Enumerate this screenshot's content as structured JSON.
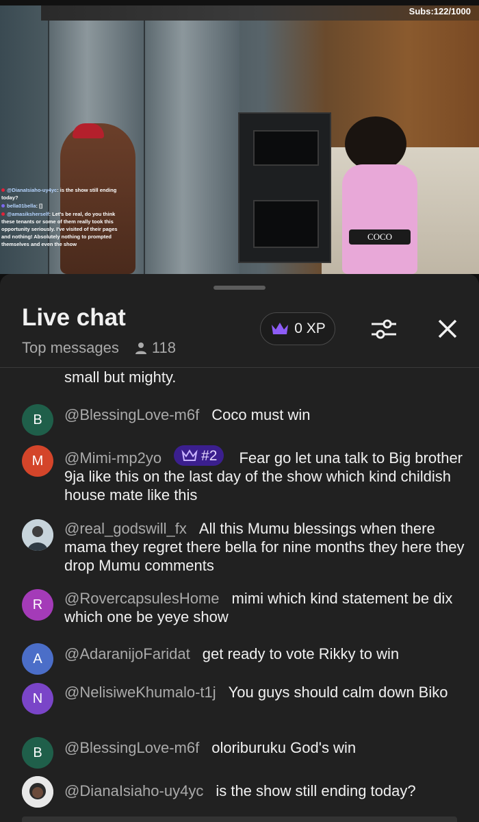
{
  "video": {
    "subs_counter": "Subs:122/1000",
    "belt_text": "COCO",
    "overlay_chat": [
      {
        "user": "@DianaIsiaho-uy4yc",
        "text": ": is the show still ending today?"
      },
      {
        "user": "bella01bella",
        "text": ": []"
      },
      {
        "user": "@amasiksherself",
        "text": ": Let's be real, do you think these tenants or some of them really took this opportunity seriously. I've visited of their pages and nothing! Absolutely nothing to prompted themselves and even the show"
      }
    ]
  },
  "panel": {
    "title": "Live chat",
    "subtitle": "Top messages",
    "viewer_count": "118",
    "xp_label": "0 XP",
    "icons": {
      "xp": "crown-icon",
      "filter": "sliders-icon",
      "close": "close-icon",
      "viewers": "person-icon"
    }
  },
  "messages": [
    {
      "avatar_letter": "",
      "avatar_color": "",
      "author": "",
      "badge": "",
      "text": "small but mighty."
    },
    {
      "avatar_letter": "B",
      "avatar_color": "#1f5f4a",
      "author": "@BlessingLove-m6f",
      "badge": "",
      "text": "Coco must win"
    },
    {
      "avatar_letter": "M",
      "avatar_color": "#d4452a",
      "author": "@Mimi-mp2yo",
      "badge": "#2",
      "text": "Fear go let una talk to Big brother 9ja like this on the last day of the show which kind childish house mate like this"
    },
    {
      "avatar_letter": "",
      "avatar_color": "#8fa6b3",
      "author": "@real_godswill_fx",
      "badge": "",
      "text": "All this Mumu blessings when there mama they regret there bella for nine months they here they drop Mumu comments"
    },
    {
      "avatar_letter": "R",
      "avatar_color": "#a43bb8",
      "author": "@RovercapsulesHome",
      "badge": "",
      "text": "mimi which kind statement be dix which one be yeye show"
    },
    {
      "avatar_letter": "A",
      "avatar_color": "#4b6ec8",
      "author": "@AdaranijoFaridat",
      "badge": "",
      "text": "get ready to vote Rikky to win"
    },
    {
      "avatar_letter": "N",
      "avatar_color": "#7a45c8",
      "author": "@NelisiweKhumalo-t1j",
      "badge": "",
      "text": "You guys should calm down Biko"
    },
    {
      "avatar_letter": "B",
      "avatar_color": "#1f5f4a",
      "author": "@BlessingLove-m6f",
      "badge": "",
      "text": "oloriburuku God's win"
    },
    {
      "avatar_letter": "",
      "avatar_color": "#d9d9d9",
      "author": "@DianaIsiaho-uy4yc",
      "badge": "",
      "text": "is the show still ending today?"
    }
  ]
}
